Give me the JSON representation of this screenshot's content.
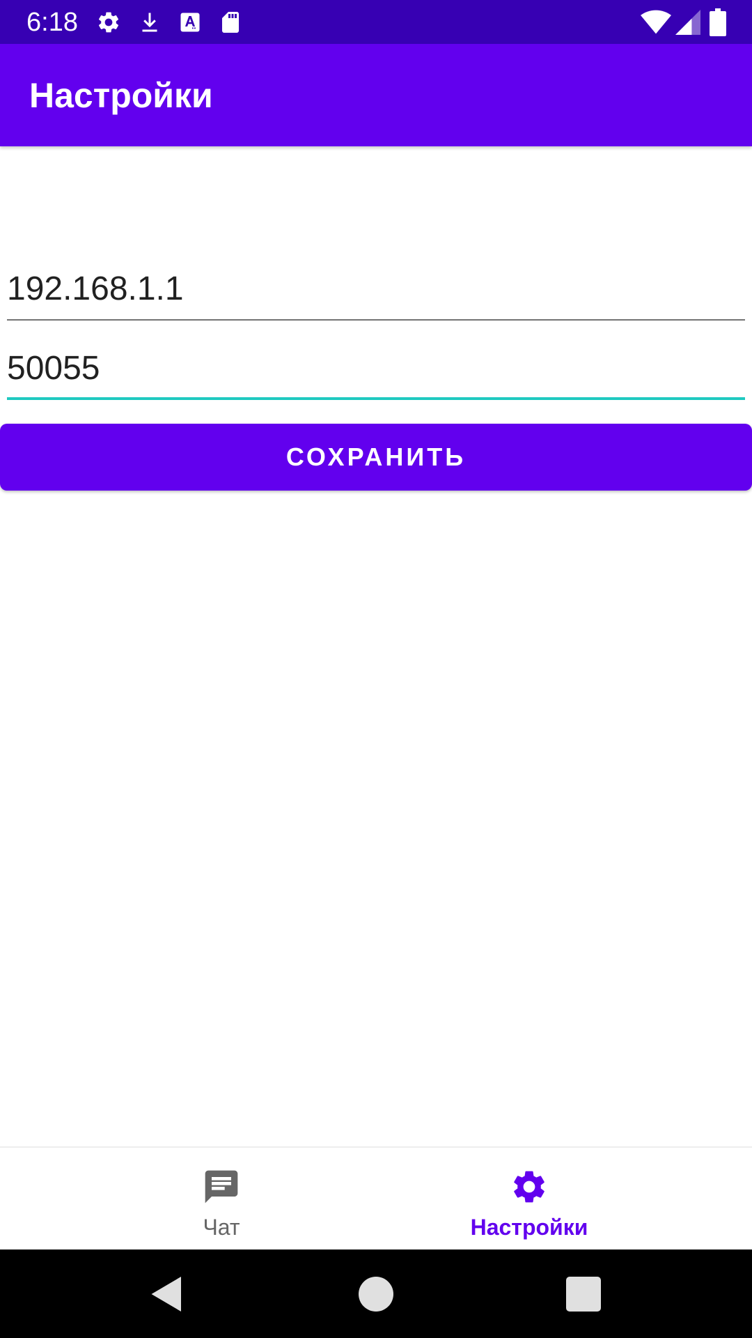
{
  "status_bar": {
    "time": "6:18",
    "left_icons": [
      "gear-icon",
      "download-icon",
      "font-a-icon",
      "sd-card-icon"
    ],
    "right_icons": [
      "wifi-icon",
      "cell-signal-icon",
      "battery-icon"
    ]
  },
  "app_bar": {
    "title": "Настройки"
  },
  "form": {
    "ip_value": "192.168.1.1",
    "port_value": "50055",
    "save_label": "СОХРАНИТЬ"
  },
  "bottom_nav": {
    "items": [
      {
        "label": "Чат",
        "icon": "chat-icon",
        "active": false
      },
      {
        "label": "Настройки",
        "icon": "gear-icon",
        "active": true
      }
    ]
  },
  "colors": {
    "status_bar": "#3700B3",
    "primary": "#6200EE",
    "field_focus": "#1FC9C0",
    "inactive_nav": "#666666"
  },
  "system_nav": {
    "buttons": [
      "back-icon",
      "home-icon",
      "recents-icon"
    ]
  }
}
